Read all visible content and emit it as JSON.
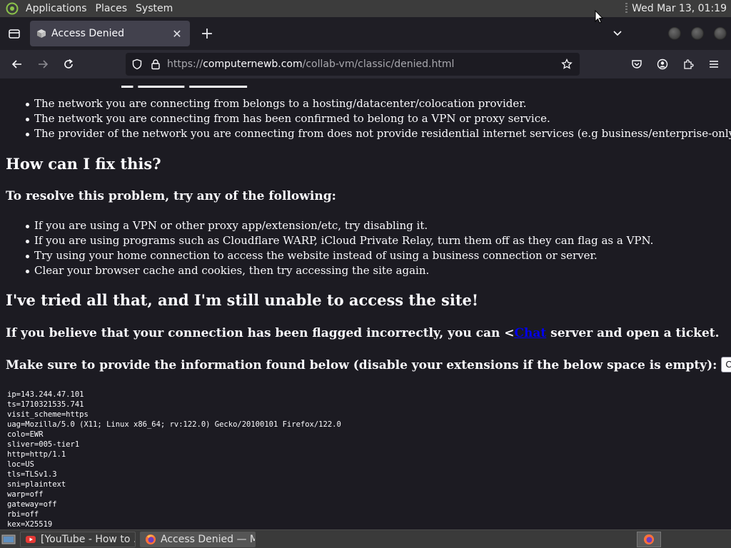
{
  "top_panel": {
    "menus": [
      "Applications",
      "Places",
      "System"
    ],
    "clock": "Wed Mar 13, 01:19"
  },
  "browser": {
    "tab": {
      "title": "Access Denied"
    },
    "url": {
      "prefix": "https://",
      "host": "computernewb.com",
      "path": "/collab-vm/classic/denied.html"
    }
  },
  "page": {
    "reasons": [
      "The network you are connecting from belongs to a hosting/datacenter/colocation provider.",
      "The network you are connecting from has been confirmed to belong to a VPN or proxy service.",
      "The provider of the network you are connecting from does not provide residential internet services (e.g business/enterprise-only networks)."
    ],
    "fix_heading": "How can I fix this?",
    "resolve_heading": "To resolve this problem, try any of the following:",
    "fixes": [
      "If you are using a VPN or other proxy app/extension/etc, try disabling it.",
      "If you are using programs such as Cloudflare WARP, iCloud Private Relay, turn them off as they can flag as a VPN.",
      "Try using your home connection to access the website instead of using a business connection or server.",
      "Clear your browser cache and cookies, then try accessing the site again."
    ],
    "tried_heading": "I've tried all that, and I'm still unable to access the site!",
    "flag_text_before": "If you believe that your connection has been flagged incorrectly, you can <",
    "flag_link": "Chat",
    "flag_text_after": " server and open a ticket.",
    "provide_text": "Make sure to provide the information found below (disable your extensions if the below space is empty):",
    "copy_button": "Copy to clipboard",
    "info_lines": [
      "ip=143.244.47.101",
      "ts=1710321535.741",
      "visit_scheme=https",
      "uag=Mozilla/5.0 (X11; Linux x86_64; rv:122.0) Gecko/20100101 Firefox/122.0",
      "colo=EWR",
      "sliver=005-tier1",
      "http=http/1.1",
      "loc=US",
      "tls=TLSv1.3",
      "sni=plaintext",
      "warp=off",
      "gateway=off",
      "rbi=off",
      "kex=X25519"
    ]
  },
  "taskbar": {
    "tasks": [
      {
        "label": "[YouTube - How to ...",
        "icon": "youtube-icon",
        "active": false
      },
      {
        "label": "Access Denied — M...",
        "icon": "firefox-icon",
        "active": true
      }
    ]
  }
}
